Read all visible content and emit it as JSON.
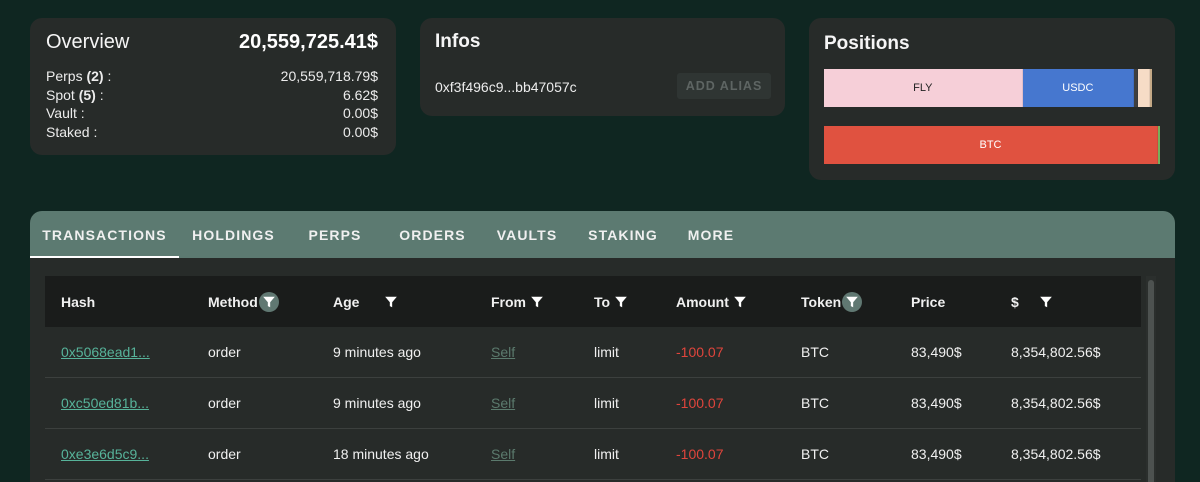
{
  "overview": {
    "title": "Overview",
    "total": "20,559,725.41$",
    "rows": [
      {
        "label": "Perps",
        "count": "(2)",
        "suffix": " :",
        "value": "20,559,718.79$"
      },
      {
        "label": "Spot",
        "count": "(5)",
        "suffix": " :",
        "value": "6.62$"
      },
      {
        "label": "Vault :",
        "count": "",
        "suffix": "",
        "value": "0.00$"
      },
      {
        "label": "Staked :",
        "count": "",
        "suffix": "",
        "value": "0.00$"
      }
    ]
  },
  "infos": {
    "title": "Infos",
    "address": "0xf3f496c9...bb47057c",
    "alias_button": "ADD ALIAS"
  },
  "positions": {
    "title": "Positions",
    "spot_bar": [
      {
        "label": "FLY",
        "share": 0.5913,
        "color": "#f6cfd8"
      },
      {
        "label": "USDC",
        "share": 0.3314,
        "color": "#4677cf"
      },
      {
        "label": "",
        "share": 0.0115,
        "color": "#3f3f3f"
      },
      {
        "label": "",
        "share": 0.0346,
        "color": "#f6dcc6"
      },
      {
        "label": "",
        "share": 0.0086,
        "color": "#c4a986"
      }
    ],
    "perps_bar": [
      {
        "label": "BTC",
        "share": 0.994,
        "color": "#e05240"
      },
      {
        "label": "",
        "share": 0.006,
        "color": "#76b05c"
      }
    ]
  },
  "tabs": [
    {
      "label": "TRANSACTIONS",
      "active": true
    },
    {
      "label": "HOLDINGS",
      "active": false
    },
    {
      "label": "PERPS",
      "active": false
    },
    {
      "label": "ORDERS",
      "active": false
    },
    {
      "label": "VAULTS",
      "active": false
    },
    {
      "label": "STAKING",
      "active": false
    },
    {
      "label": "MORE",
      "active": false
    }
  ],
  "table": {
    "columns": [
      {
        "key": "hash",
        "label": "Hash",
        "filter": "none"
      },
      {
        "key": "method",
        "label": "Method",
        "filter": "highlight"
      },
      {
        "key": "age",
        "label": "Age",
        "filter": "plain"
      },
      {
        "key": "from",
        "label": "From",
        "filter": "plain"
      },
      {
        "key": "to",
        "label": "To",
        "filter": "plain"
      },
      {
        "key": "amount",
        "label": "Amount",
        "filter": "plain"
      },
      {
        "key": "token",
        "label": "Token",
        "filter": "highlight"
      },
      {
        "key": "price",
        "label": "Price",
        "filter": "none"
      },
      {
        "key": "usd",
        "label": "$",
        "filter": "plain"
      }
    ],
    "rows": [
      {
        "hash": "0x5068ead1...",
        "method": "order",
        "age": "9 minutes ago",
        "from": "Self",
        "to": "limit",
        "amount": "-100.07",
        "token": "BTC",
        "price": "83,490$",
        "usd": "8,354,802.56$"
      },
      {
        "hash": "0xc50ed81b...",
        "method": "order",
        "age": "9 minutes ago",
        "from": "Self",
        "to": "limit",
        "amount": "-100.07",
        "token": "BTC",
        "price": "83,490$",
        "usd": "8,354,802.56$"
      },
      {
        "hash": "0xe3e6d5c9...",
        "method": "order",
        "age": "18 minutes ago",
        "from": "Self",
        "to": "limit",
        "amount": "-100.07",
        "token": "BTC",
        "price": "83,490$",
        "usd": "8,354,802.56$"
      }
    ]
  },
  "colors": {
    "page_bg": "#0f2621",
    "card_bg": "#272b29",
    "tabbar_bg": "#5c7a71",
    "hash_link": "#57b39a",
    "negative": "#e0453c"
  }
}
